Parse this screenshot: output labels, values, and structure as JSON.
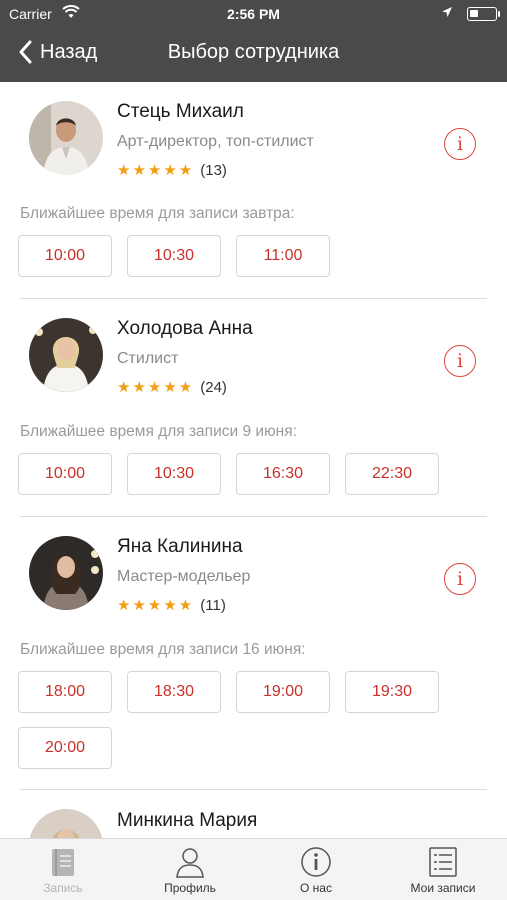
{
  "status_bar": {
    "carrier": "Carrier",
    "time": "2:56 PM"
  },
  "nav": {
    "back_label": "Назад",
    "title": "Выбор сотрудника"
  },
  "employees": [
    {
      "name": "Стець Михаил",
      "role": "Арт-директор, топ-стилист",
      "stars": "★★★★★",
      "reviews": "(13)",
      "nearest_label": "Ближайшее время для записи завтра:",
      "slots": [
        "10:00",
        "10:30",
        "11:00"
      ]
    },
    {
      "name": "Холодова Анна",
      "role": "Стилист",
      "stars": "★★★★★",
      "reviews": "(24)",
      "nearest_label": "Ближайшее время для записи 9 июня:",
      "slots": [
        "10:00",
        "10:30",
        "16:30",
        "22:30"
      ]
    },
    {
      "name": "Яна Калинина",
      "role": "Мастер-модельер",
      "stars": "★★★★★",
      "reviews": "(11)",
      "nearest_label": "Ближайшее время для записи 16 июня:",
      "slots": [
        "18:00",
        "18:30",
        "19:00",
        "19:30",
        "20:00"
      ]
    },
    {
      "name": "Минкина Мария"
    }
  ],
  "tabbar": {
    "tabs": [
      {
        "label": "Запись",
        "icon": "book-icon"
      },
      {
        "label": "Профиль",
        "icon": "person-icon"
      },
      {
        "label": "О нас",
        "icon": "info-icon"
      },
      {
        "label": "Мои записи",
        "icon": "list-icon"
      }
    ]
  },
  "colors": {
    "accent": "#c8312a",
    "stars": "#f29d12",
    "nav_bg": "#4a4a4a"
  }
}
